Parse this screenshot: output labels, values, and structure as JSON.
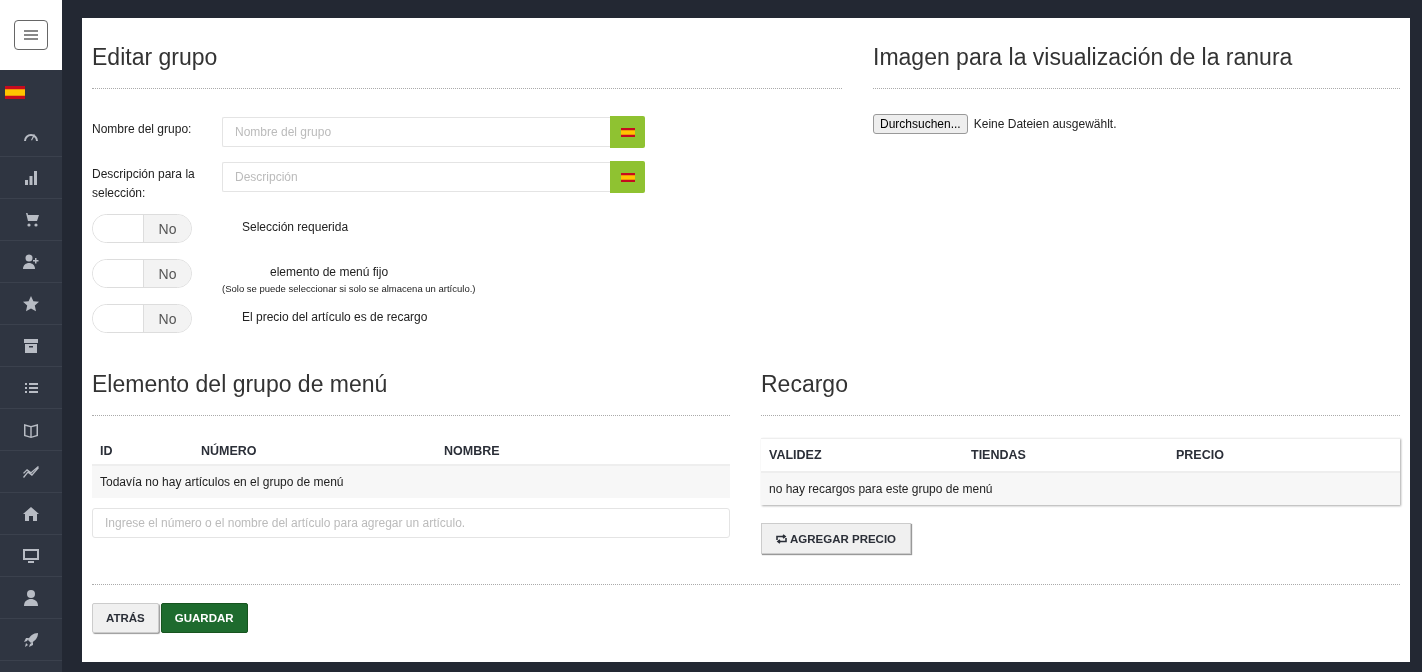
{
  "editar": {
    "title": "Editar grupo",
    "fields": [
      {
        "label": "Nombre del grupo:",
        "placeholder": "Nombre del grupo"
      },
      {
        "label": "Descripción para la selección:",
        "placeholder": "Descripción"
      }
    ],
    "toggles": [
      {
        "state_text": "No",
        "on": false,
        "label": "Selección requerida"
      },
      {
        "state_text": "No",
        "on": false,
        "label": "elemento de menú fijo",
        "note": "(Solo se puede seleccionar si solo se almacena un artículo.)"
      },
      {
        "state_text": "No",
        "on": false,
        "label": "El precio del artículo es de recargo"
      }
    ]
  },
  "imagen": {
    "title": "Imagen para la visualización de la ranura",
    "browse_button": "Durchsuchen...",
    "file_status": "Keine Dateien ausgewählt."
  },
  "menu_items": {
    "title": "Elemento del grupo de menú",
    "columns": [
      "ID",
      "NÚMERO",
      "NOMBRE"
    ],
    "empty_text": "Todavía no hay artículos en el grupo de menú",
    "search": {
      "placeholder": "Ingrese el número o el nombre del artículo para agregar un artículo."
    }
  },
  "recargo": {
    "title": "Recargo",
    "columns": [
      "VALIDEZ",
      "TIENDAS",
      "PRECIO"
    ],
    "empty_text": "no hay recargos para este grupo de menú",
    "add_button": "AGREGAR PRECIO"
  },
  "buttons": [
    {
      "label": "ATRÁS",
      "kind": "default"
    },
    {
      "label": "GUARDAR",
      "kind": "primary"
    }
  ]
}
